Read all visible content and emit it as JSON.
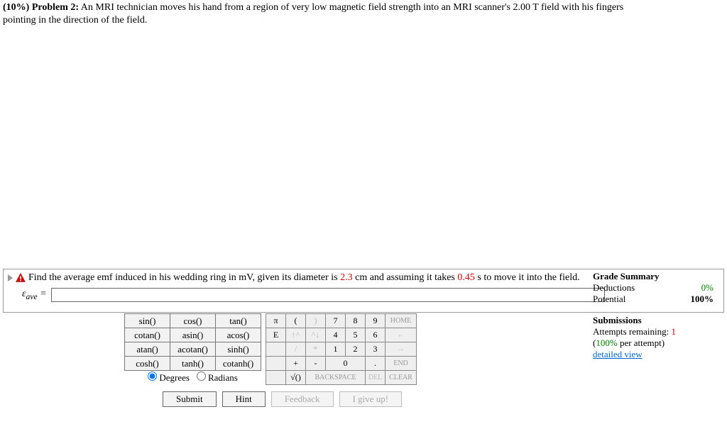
{
  "problem": {
    "percent": "(10%)",
    "label": "Problem 2:",
    "text_a": "An MRI technician moves his hand from a region of very low magnetic field strength into an MRI scanner's 2.00 T field with his fingers",
    "text_b": "pointing in the direction of the field."
  },
  "part": {
    "q_a": "Find the average emf induced in his wedding ring in mV, given its diameter is ",
    "val1": "2.3",
    "q_b": " cm and assuming it takes ",
    "val2": "0.45",
    "q_c": " s to move it into the field.",
    "var": "ε",
    "sub": "ave",
    "eq": " = "
  },
  "grade": {
    "title": "Grade Summary",
    "ded_label": "Deductions",
    "ded_val": "0%",
    "pot_label": "Potential",
    "pot_val": "100%"
  },
  "subs": {
    "title": "Submissions",
    "att_a": "Attempts remaining: ",
    "att_n": "1",
    "per_a": "(",
    "per_v": "100%",
    "per_b": " per attempt)",
    "det": "detailed view"
  },
  "fn": {
    "r1c1": "sin()",
    "r1c2": "cos()",
    "r1c3": "tan()",
    "r2c1": "cotan()",
    "r2c2": "asin()",
    "r2c3": "acos()",
    "r3c1": "atan()",
    "r3c2": "acotan()",
    "r3c3": "sinh()",
    "r4c1": "cosh()",
    "r4c2": "tanh()",
    "r4c3": "cotanh()"
  },
  "mode": {
    "deg": "Degrees",
    "rad": "Radians"
  },
  "num": {
    "pi": "π",
    "lp": "(",
    "rp": ")",
    "n7": "7",
    "n8": "8",
    "n9": "9",
    "home": "HOME",
    "E": "E",
    "up": "↑^",
    "dn": "^↓",
    "n4": "4",
    "n5": "5",
    "n6": "6",
    "lf": "←",
    "sl": "/",
    "as": "*",
    "n1": "1",
    "n2": "2",
    "n3": "3",
    "rt": "→",
    "pl": "+",
    "mi": "-",
    "n0": "0",
    "dot": ".",
    "end": "END",
    "sq": "√()",
    "bs": "BACKSPACE",
    "del": "DEL",
    "clr": "CLEAR"
  },
  "btns": {
    "submit": "Submit",
    "hint": "Hint",
    "fb": "Feedback",
    "give": "I give up!"
  }
}
